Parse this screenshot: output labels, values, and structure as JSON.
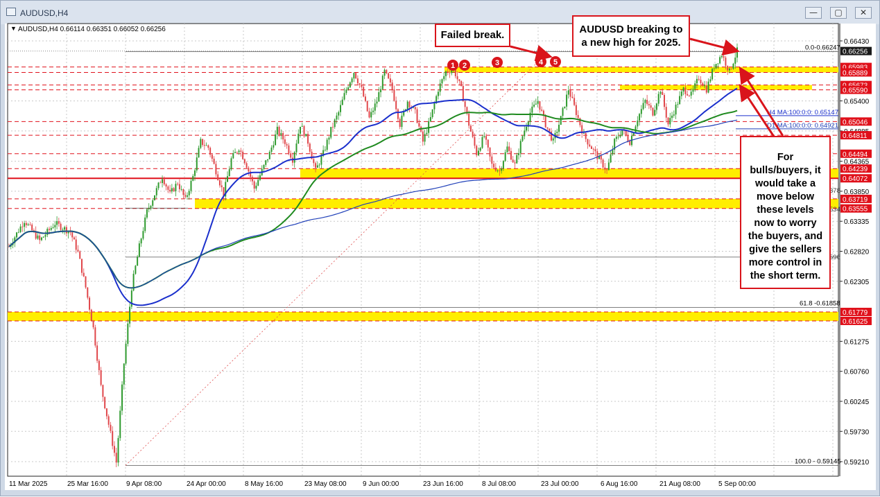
{
  "window": {
    "title": "AUDUSD,H4",
    "minimize_glyph": "—",
    "maximize_glyph": "▢",
    "close_glyph": "✕"
  },
  "chart_header": {
    "text": "AUDUSD,H4  0.66114 0.66351 0.66052 0.66256",
    "menu_glyph": "▼"
  },
  "colors": {
    "bull_candle": "#2e9a2e",
    "bear_candle": "#e0464a",
    "ma_blue": "#1a2fcc",
    "ma_green": "#1f8a1f",
    "ma_d1_blue": "#1f3fb8",
    "support_zone": "#ffee00",
    "red_line": "#e0101a",
    "annotation_red": "#d9141b",
    "current_price_bg": "#1a1a1a"
  },
  "chart_data": {
    "type": "line",
    "symbol": "AUDUSD",
    "timeframe": "H4",
    "ylim": [
      0.5905,
      0.666
    ],
    "x_tick_labels": [
      "11 Mar 2025",
      "25 Mar 16:00",
      "9 Apr 08:00",
      "24 Apr 00:00",
      "8 May 16:00",
      "23 May 08:00",
      "9 Jun 00:00",
      "23 Jun 16:00",
      "8 Jul 08:00",
      "23 Jul 00:00",
      "6 Aug 16:00",
      "21 Aug 08:00",
      "5 Sep 00:00"
    ],
    "y_tick_labels": [
      "0.66430",
      "0.65400",
      "0.64885",
      "0.64365",
      "0.63850",
      "0.63335",
      "0.62820",
      "0.62305",
      "0.61275",
      "0.60760",
      "0.60245",
      "0.59730",
      "0.59210"
    ],
    "y_tick_values": [
      0.6643,
      0.654,
      0.64885,
      0.64365,
      0.6385,
      0.63335,
      0.6282,
      0.62305,
      0.61275,
      0.6076,
      0.60245,
      0.5973,
      0.5921
    ],
    "price_path": {
      "x": [
        0,
        4,
        8,
        12,
        16,
        18,
        20,
        22,
        24,
        26,
        28,
        30,
        32,
        34,
        36,
        38,
        40,
        42,
        44,
        46,
        48,
        50,
        52,
        54,
        56,
        58,
        60,
        62,
        64,
        66,
        68,
        70,
        72,
        74,
        76,
        78,
        80,
        82,
        84,
        86,
        88,
        90,
        92,
        94,
        96,
        98,
        100,
        102,
        104,
        106,
        108,
        110,
        112,
        114,
        116,
        118,
        120,
        122,
        124,
        126,
        128,
        130,
        132,
        134,
        136,
        138,
        140,
        142,
        144,
        146,
        148,
        150,
        152,
        154,
        156,
        158,
        160,
        162,
        164,
        166,
        168,
        170,
        172,
        174,
        176,
        178,
        180,
        182,
        184,
        186,
        188,
        190
      ],
      "close": [
        0.629,
        0.6335,
        0.63,
        0.633,
        0.6315,
        0.628,
        0.622,
        0.615,
        0.605,
        0.5985,
        0.592,
        0.609,
        0.622,
        0.629,
        0.635,
        0.638,
        0.641,
        0.638,
        0.64,
        0.637,
        0.641,
        0.647,
        0.646,
        0.642,
        0.638,
        0.644,
        0.646,
        0.643,
        0.639,
        0.642,
        0.645,
        0.649,
        0.647,
        0.644,
        0.65,
        0.647,
        0.642,
        0.645,
        0.649,
        0.652,
        0.656,
        0.659,
        0.656,
        0.651,
        0.654,
        0.659,
        0.656,
        0.65,
        0.654,
        0.652,
        0.647,
        0.651,
        0.656,
        0.659,
        0.6595,
        0.656,
        0.65,
        0.645,
        0.648,
        0.643,
        0.642,
        0.646,
        0.643,
        0.648,
        0.652,
        0.654,
        0.65,
        0.647,
        0.651,
        0.656,
        0.652,
        0.648,
        0.646,
        0.644,
        0.642,
        0.647,
        0.649,
        0.647,
        0.651,
        0.654,
        0.652,
        0.656,
        0.65,
        0.653,
        0.656,
        0.655,
        0.658,
        0.656,
        0.66,
        0.662,
        0.659,
        0.6626
      ]
    },
    "series": [
      {
        "name": "H4 MA:100:0:0: 0.65147",
        "color": "#1a2fcc",
        "last": 0.65147
      },
      {
        "name": "D1 MA:100:0:0: 0.64921",
        "color": "#1f3fb8",
        "last": 0.64921
      },
      {
        "name": "H4 MA:200",
        "color": "#1f8a1f"
      }
    ],
    "price_level_labels": [
      {
        "label": "0.66256",
        "value": 0.66256,
        "style": "current"
      },
      {
        "label": "0.65983",
        "value": 0.65983,
        "style": "red"
      },
      {
        "label": "0.65889",
        "value": 0.65889,
        "style": "red"
      },
      {
        "label": "0.65673",
        "value": 0.65673,
        "style": "red"
      },
      {
        "label": "0.65590",
        "value": 0.6559,
        "style": "red"
      },
      {
        "label": "0.65046",
        "value": 0.65046,
        "style": "red"
      },
      {
        "label": "0.64811",
        "value": 0.64811,
        "style": "red"
      },
      {
        "label": "0.64494",
        "value": 0.64494,
        "style": "red"
      },
      {
        "label": "0.64239",
        "value": 0.64239,
        "style": "red"
      },
      {
        "label": "0.64072",
        "value": 0.64072,
        "style": "red"
      },
      {
        "label": "0.63719",
        "value": 0.63719,
        "style": "red"
      },
      {
        "label": "0.63555",
        "value": 0.63555,
        "style": "red"
      },
      {
        "label": "0.61779",
        "value": 0.61779,
        "style": "red"
      },
      {
        "label": "0.61625",
        "value": 0.61625,
        "style": "red"
      }
    ],
    "fib_levels": [
      {
        "label": "0.0-0.66247",
        "value": 0.66247
      },
      {
        "label": "61.8 -0.61858",
        "value": 0.61858
      },
      {
        "label": "100.0 - 0.59145",
        "value": 0.59145
      }
    ],
    "partial_labels": [
      {
        "label": "378",
        "value": 0.6387
      },
      {
        "label": "534",
        "value": 0.6355
      },
      {
        "label": "596",
        "value": 0.6273
      }
    ],
    "support_zones": [
      {
        "top": 0.65983,
        "bottom": 0.65889
      },
      {
        "top": 0.65673,
        "bottom": 0.6559
      },
      {
        "top": 0.64239,
        "bottom": 0.64072
      },
      {
        "top": 0.63719,
        "bottom": 0.63555
      },
      {
        "top": 0.61779,
        "bottom": 0.61625
      }
    ],
    "red_line_level": 0.64072,
    "swing_markers": [
      "1",
      "2",
      "3",
      "4",
      "5"
    ]
  },
  "annotations": {
    "failed_break": "Failed break.",
    "audusd_high_line1": "AUDUSD breaking to",
    "audusd_high_line2": "a new high for 2025.",
    "bulls_text": [
      "For",
      "bulls/buyers, it",
      "would take a",
      "move below",
      "these levels",
      "now to worry",
      "the buyers, and",
      "give the sellers",
      "more control in",
      "the short term."
    ]
  }
}
